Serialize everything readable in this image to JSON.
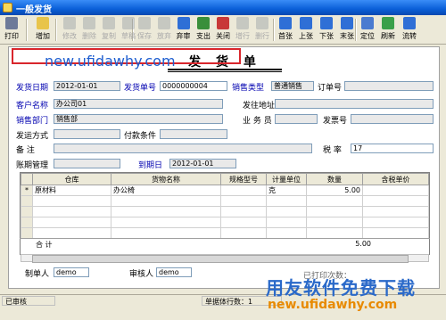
{
  "window": {
    "title": "一般发货"
  },
  "toolbar": {
    "buttons": [
      {
        "label": "打印",
        "icon": "printer-icon",
        "color": "#6d7a99",
        "enabled": true
      },
      {
        "label": "增加",
        "icon": "add-icon",
        "color": "#e8c44a",
        "enabled": true
      },
      {
        "label": "修改",
        "icon": "edit-icon",
        "color": "#9aa0a6",
        "enabled": false
      },
      {
        "label": "删除",
        "icon": "delete-icon",
        "color": "#9aa0a6",
        "enabled": false
      },
      {
        "label": "复制",
        "icon": "copy-icon",
        "color": "#9aa0a6",
        "enabled": false
      },
      {
        "label": "草稿",
        "icon": "draft-icon",
        "color": "#9aa0a6",
        "enabled": false
      },
      {
        "label": "保存",
        "icon": "save-icon",
        "color": "#9aa0a6",
        "enabled": false
      },
      {
        "label": "放弃",
        "icon": "discard-icon",
        "color": "#9aa0a6",
        "enabled": false
      },
      {
        "label": "弃审",
        "icon": "unapprove-icon",
        "color": "#2f6fd6",
        "enabled": true
      },
      {
        "label": "支出",
        "icon": "payout-icon",
        "color": "#3a8f3a",
        "enabled": true
      },
      {
        "label": "关闭",
        "icon": "close-doc-icon",
        "color": "#c83838",
        "enabled": true
      },
      {
        "label": "增行",
        "icon": "add-row-icon",
        "color": "#9aa0a6",
        "enabled": false
      },
      {
        "label": "删行",
        "icon": "delete-row-icon",
        "color": "#9aa0a6",
        "enabled": false
      },
      {
        "label": "首张",
        "icon": "first-icon",
        "color": "#2f6fd6",
        "enabled": true
      },
      {
        "label": "上张",
        "icon": "previous-icon",
        "color": "#2f6fd6",
        "enabled": true
      },
      {
        "label": "下张",
        "icon": "next-icon",
        "color": "#2f6fd6",
        "enabled": true
      },
      {
        "label": "末张",
        "icon": "last-icon",
        "color": "#2f6fd6",
        "enabled": true
      },
      {
        "label": "定位",
        "icon": "locate-icon",
        "color": "#4a7bd0",
        "enabled": true
      },
      {
        "label": "刷新",
        "icon": "refresh-icon",
        "color": "#3aa04a",
        "enabled": true
      },
      {
        "label": "流转",
        "icon": "flow-icon",
        "color": "#2f6fd6",
        "enabled": true
      }
    ]
  },
  "form": {
    "heading": "发 货 单",
    "labels": {
      "ship_date": "发货日期",
      "ship_no": "发货单号",
      "sales_type": "销售类型",
      "order_no": "订单号",
      "customer": "客户名称",
      "ship_address": "发往地址",
      "dept": "销售部门",
      "salesperson": "业 务 员",
      "invoice_no": "发票号",
      "ship_method": "发运方式",
      "pay_terms": "付款条件",
      "remark": "备    注",
      "tax_rate": "税  率",
      "account_mgmt": "账期管理",
      "due_date": "到期日"
    },
    "values": {
      "ship_date": "2012-01-01",
      "ship_no": "0000000004",
      "sales_type": "普通销售",
      "order_no": "",
      "customer": "办公司01",
      "ship_address": "",
      "dept": "销售部",
      "salesperson": "",
      "invoice_no": "",
      "ship_method": "",
      "pay_terms": "",
      "remark": "",
      "tax_rate": "17",
      "account_mgmt": "",
      "due_date": "2012-01-01"
    },
    "watermark_url": "new.ufidawhy.com"
  },
  "grid": {
    "columns": [
      "仓库",
      "货物名称",
      "规格型号",
      "计量单位",
      "数量",
      "含税单价"
    ],
    "rows": [
      {
        "marker": "*",
        "warehouse": "原材料",
        "item": "办公椅",
        "spec": "",
        "unit": "克",
        "qty": "5.00",
        "price": ""
      }
    ],
    "total_label": "合  计",
    "total_qty": "5.00"
  },
  "footer": {
    "maker_label": "制单人",
    "maker": "demo",
    "approver_label": "审核人",
    "approver": "demo",
    "print_count": "已打印次数："
  },
  "status": {
    "state": "已审核",
    "rows_label": "单据体行数：1"
  },
  "watermark": {
    "cn": "用友软件免费下载",
    "url": "new.ufidawhy.com"
  }
}
